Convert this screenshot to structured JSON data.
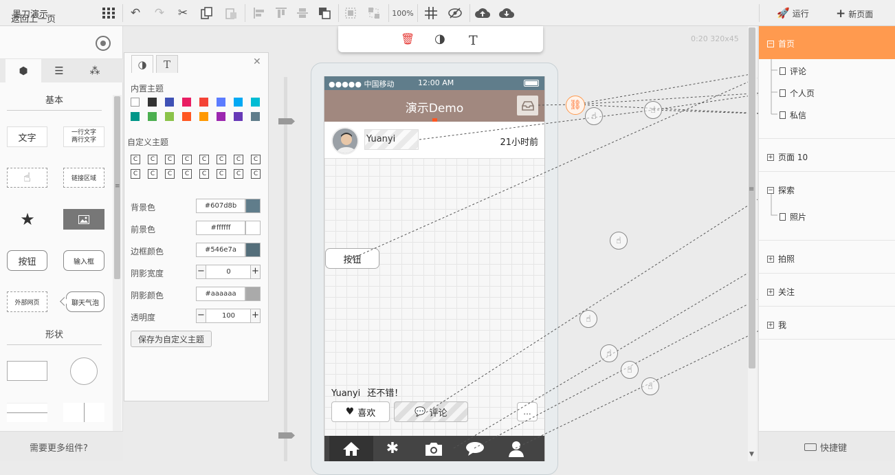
{
  "app": {
    "title": "墨刀演示"
  },
  "toolbar": {
    "zoom": "100%",
    "run": "运行",
    "new_page": "新页面"
  },
  "left_panel": {
    "back": "返回上一页",
    "section_basic": "基本",
    "section_shape": "形状",
    "items": {
      "text": "文字",
      "multiline": "一行文字\n两行文字",
      "link_area": "链接区域",
      "button": "按钮",
      "input": "输入框",
      "webpage": "外部网页",
      "bubble": "聊天气泡"
    },
    "bottom": "需要更多组件?"
  },
  "props": {
    "builtin_theme": "内置主题",
    "custom_theme": "自定义主题",
    "bg_label": "背景色",
    "bg_value": "#607d8b",
    "fg_label": "前景色",
    "fg_value": "#ffffff",
    "border_label": "边框颜色",
    "border_value": "#546e7a",
    "shadow_width_label": "阴影宽度",
    "shadow_width_value": "0",
    "shadow_color_label": "阴影颜色",
    "shadow_color_value": "#aaaaaa",
    "opacity_label": "透明度",
    "opacity_value": "100",
    "save_button": "保存为自定义主题",
    "custom_cell": "C",
    "colors": {
      "row1": [
        "#ffffff",
        "#333333",
        "#3f51b5",
        "#e91e63",
        "#f44336",
        "#5b7cff",
        "#03a9f4",
        "#00bcd4"
      ],
      "row2": [
        "#009688",
        "#4caf50",
        "#8bc34a",
        "#ff5722",
        "#ff9800",
        "#9c27b0",
        "#673ab7",
        "#607d8b"
      ],
      "bg": "#607d8b",
      "fg": "#ffffff",
      "border": "#546e7a",
      "shadow": "#aaaaaa"
    }
  },
  "canvas": {
    "info": "0:20 320x45"
  },
  "phone": {
    "carrier": "●●●●● 中国移动",
    "time": "12:00 AM",
    "title": "演示Demo",
    "user": "Yuanyi",
    "ago": "21小时前",
    "button": "按钮",
    "comment_user": "Yuanyi",
    "comment_text": "还不错！",
    "like": "喜欢",
    "comment": "评论",
    "more": "...",
    "colors": {
      "status": "#607d8b",
      "nav": "#a1887f",
      "tabbar": "#444444"
    }
  },
  "pages": {
    "home": "首页",
    "home_children": [
      "评论",
      "个人页",
      "私信"
    ],
    "page10": "页面 10",
    "explore": "探索",
    "explore_children": [
      "照片"
    ],
    "camera": "拍照",
    "follow": "关注",
    "me": "我",
    "selected_color": "#ff9a4f"
  },
  "shortcut": "快捷键"
}
